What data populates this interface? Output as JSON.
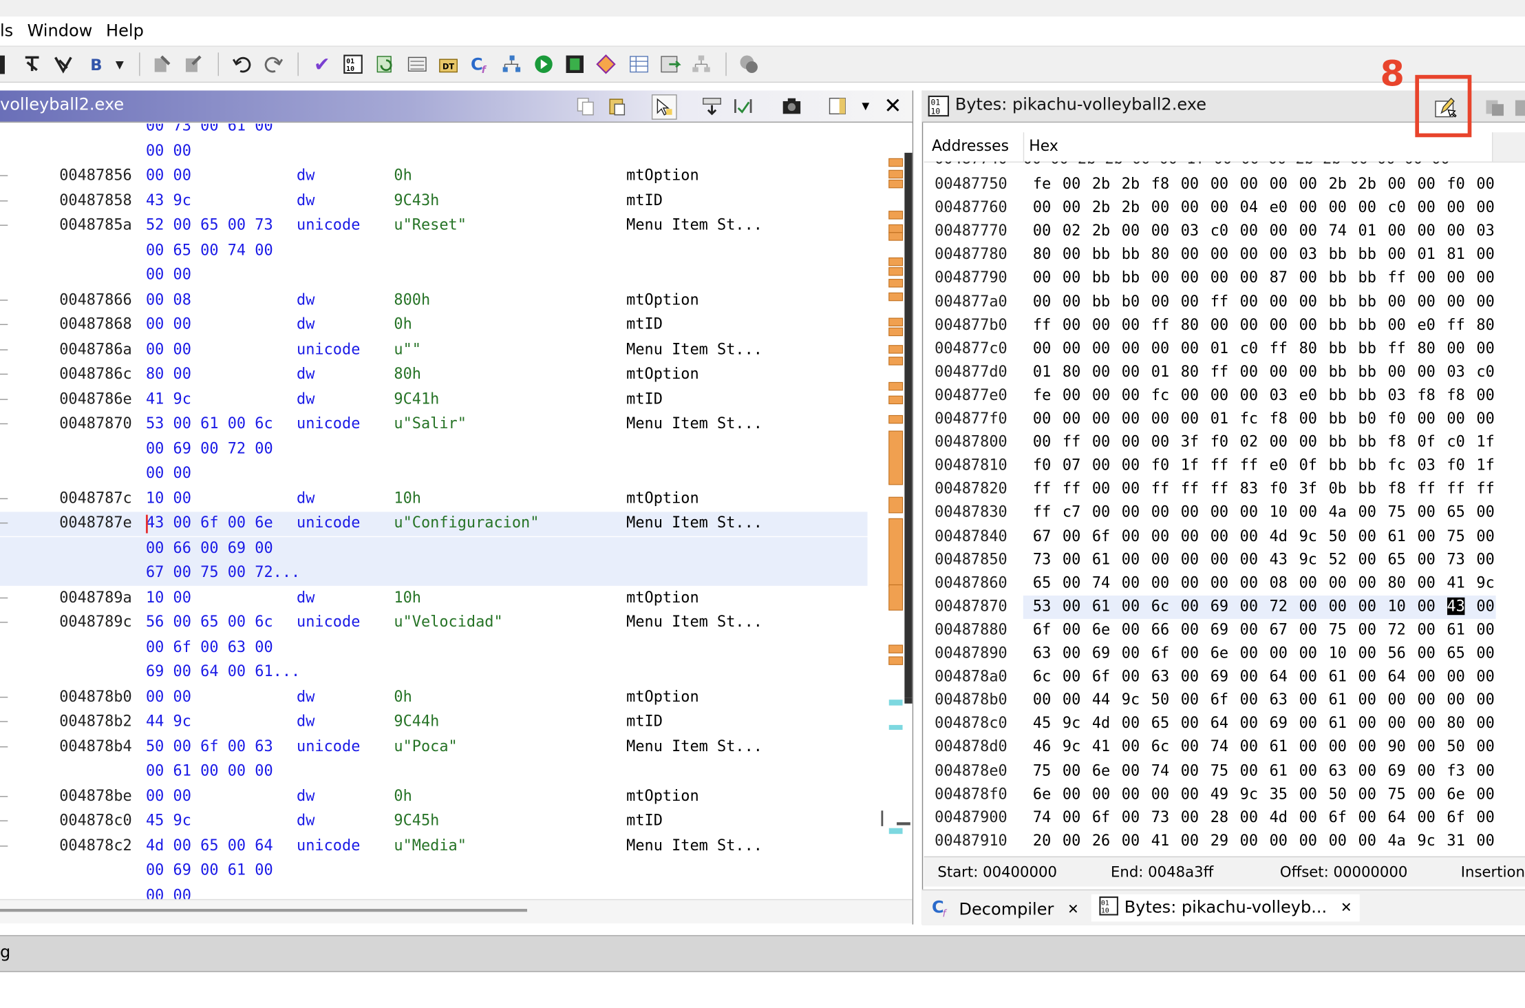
{
  "menu": {
    "items": [
      "ls",
      "Window",
      "Help"
    ]
  },
  "listing": {
    "title": "volleyball2.exe",
    "rows": [
      {
        "addr": "",
        "bytes": "00 73 00 61 00",
        "mnem": "",
        "oper": "",
        "cmt": "",
        "tick": false
      },
      {
        "addr": "",
        "bytes": "00 00",
        "mnem": "",
        "oper": "",
        "cmt": "",
        "tick": false
      },
      {
        "addr": "00487856",
        "bytes": "00 00",
        "mnem": "dw",
        "oper": "0h",
        "cmt": "mtOption",
        "tick": true
      },
      {
        "addr": "00487858",
        "bytes": "43 9c",
        "mnem": "dw",
        "oper": "9C43h",
        "cmt": "mtID",
        "tick": true
      },
      {
        "addr": "0048785a",
        "bytes": "52 00 65 00 73",
        "mnem": "unicode",
        "oper": "u\"Reset\"",
        "cmt": "Menu Item St...",
        "tick": true
      },
      {
        "addr": "",
        "bytes": "00 65 00 74 00",
        "mnem": "",
        "oper": "",
        "cmt": "",
        "tick": false
      },
      {
        "addr": "",
        "bytes": "00 00",
        "mnem": "",
        "oper": "",
        "cmt": "",
        "tick": false
      },
      {
        "addr": "00487866",
        "bytes": "00 08",
        "mnem": "dw",
        "oper": "800h",
        "cmt": "mtOption",
        "tick": true
      },
      {
        "addr": "00487868",
        "bytes": "00 00",
        "mnem": "dw",
        "oper": "0h",
        "cmt": "mtID",
        "tick": true
      },
      {
        "addr": "0048786a",
        "bytes": "00 00",
        "mnem": "unicode",
        "oper": "u\"\"",
        "cmt": "Menu Item St...",
        "tick": true
      },
      {
        "addr": "0048786c",
        "bytes": "80 00",
        "mnem": "dw",
        "oper": "80h",
        "cmt": "mtOption",
        "tick": true
      },
      {
        "addr": "0048786e",
        "bytes": "41 9c",
        "mnem": "dw",
        "oper": "9C41h",
        "cmt": "mtID",
        "tick": true
      },
      {
        "addr": "00487870",
        "bytes": "53 00 61 00 6c",
        "mnem": "unicode",
        "oper": "u\"Salir\"",
        "cmt": "Menu Item St...",
        "tick": true
      },
      {
        "addr": "",
        "bytes": "00 69 00 72 00",
        "mnem": "",
        "oper": "",
        "cmt": "",
        "tick": false
      },
      {
        "addr": "",
        "bytes": "00 00",
        "mnem": "",
        "oper": "",
        "cmt": "",
        "tick": false
      },
      {
        "addr": "0048787c",
        "bytes": "10 00",
        "mnem": "dw",
        "oper": "10h",
        "cmt": "mtOption",
        "tick": true
      },
      {
        "addr": "0048787e",
        "bytes": "43 00 6f 00 6e",
        "mnem": "unicode",
        "oper": "u\"Configuracion\"",
        "cmt": "Menu Item St...",
        "tick": true,
        "sel": true,
        "cursor": true
      },
      {
        "addr": "",
        "bytes": "00 66 00 69 00",
        "mnem": "",
        "oper": "",
        "cmt": "",
        "tick": false,
        "sel": true
      },
      {
        "addr": "",
        "bytes": "67 00 75 00 72...",
        "mnem": "",
        "oper": "",
        "cmt": "",
        "tick": false,
        "sel": true
      },
      {
        "addr": "0048789a",
        "bytes": "10 00",
        "mnem": "dw",
        "oper": "10h",
        "cmt": "mtOption",
        "tick": true
      },
      {
        "addr": "0048789c",
        "bytes": "56 00 65 00 6c",
        "mnem": "unicode",
        "oper": "u\"Velocidad\"",
        "cmt": "Menu Item St...",
        "tick": true
      },
      {
        "addr": "",
        "bytes": "00 6f 00 63 00",
        "mnem": "",
        "oper": "",
        "cmt": "",
        "tick": false
      },
      {
        "addr": "",
        "bytes": "69 00 64 00 61...",
        "mnem": "",
        "oper": "",
        "cmt": "",
        "tick": false
      },
      {
        "addr": "004878b0",
        "bytes": "00 00",
        "mnem": "dw",
        "oper": "0h",
        "cmt": "mtOption",
        "tick": true
      },
      {
        "addr": "004878b2",
        "bytes": "44 9c",
        "mnem": "dw",
        "oper": "9C44h",
        "cmt": "mtID",
        "tick": true
      },
      {
        "addr": "004878b4",
        "bytes": "50 00 6f 00 63",
        "mnem": "unicode",
        "oper": "u\"Poca\"",
        "cmt": "Menu Item St...",
        "tick": true
      },
      {
        "addr": "",
        "bytes": "00 61 00 00 00",
        "mnem": "",
        "oper": "",
        "cmt": "",
        "tick": false
      },
      {
        "addr": "004878be",
        "bytes": "00 00",
        "mnem": "dw",
        "oper": "0h",
        "cmt": "mtOption",
        "tick": true
      },
      {
        "addr": "004878c0",
        "bytes": "45 9c",
        "mnem": "dw",
        "oper": "9C45h",
        "cmt": "mtID",
        "tick": true
      },
      {
        "addr": "004878c2",
        "bytes": "4d 00 65 00 64",
        "mnem": "unicode",
        "oper": "u\"Media\"",
        "cmt": "Menu Item St...",
        "tick": true
      },
      {
        "addr": "",
        "bytes": "00 69 00 61 00",
        "mnem": "",
        "oper": "",
        "cmt": "",
        "tick": false
      },
      {
        "addr": "",
        "bytes": "00 00",
        "mnem": "",
        "oper": "",
        "cmt": "",
        "tick": false
      }
    ]
  },
  "bytes_panel": {
    "title": "Bytes: pikachu-volleyball2.exe",
    "col_addresses": "Addresses",
    "col_hex": "Hex",
    "rows": [
      {
        "addr": "00487750",
        "hex": [
          "fe",
          "00",
          "2b",
          "2b",
          "f8",
          "00",
          "00",
          "00",
          "00",
          "00",
          "2b",
          "2b",
          "00",
          "00",
          "f0",
          "00"
        ]
      },
      {
        "addr": "00487760",
        "hex": [
          "00",
          "00",
          "2b",
          "2b",
          "00",
          "00",
          "00",
          "04",
          "e0",
          "00",
          "00",
          "00",
          "c0",
          "00",
          "00",
          "00"
        ]
      },
      {
        "addr": "00487770",
        "hex": [
          "00",
          "02",
          "2b",
          "00",
          "00",
          "03",
          "c0",
          "00",
          "00",
          "00",
          "74",
          "01",
          "00",
          "00",
          "00",
          "03"
        ]
      },
      {
        "addr": "00487780",
        "hex": [
          "80",
          "00",
          "bb",
          "bb",
          "80",
          "00",
          "00",
          "00",
          "00",
          "03",
          "bb",
          "bb",
          "00",
          "01",
          "81",
          "00"
        ]
      },
      {
        "addr": "00487790",
        "hex": [
          "00",
          "00",
          "bb",
          "bb",
          "00",
          "00",
          "00",
          "00",
          "87",
          "00",
          "bb",
          "bb",
          "ff",
          "00",
          "00",
          "00"
        ]
      },
      {
        "addr": "004877a0",
        "hex": [
          "00",
          "00",
          "bb",
          "b0",
          "00",
          "00",
          "ff",
          "00",
          "00",
          "00",
          "bb",
          "bb",
          "00",
          "00",
          "00",
          "00"
        ]
      },
      {
        "addr": "004877b0",
        "hex": [
          "ff",
          "00",
          "00",
          "00",
          "ff",
          "80",
          "00",
          "00",
          "00",
          "00",
          "bb",
          "bb",
          "00",
          "e0",
          "ff",
          "80"
        ]
      },
      {
        "addr": "004877c0",
        "hex": [
          "00",
          "00",
          "00",
          "00",
          "00",
          "00",
          "01",
          "c0",
          "ff",
          "80",
          "bb",
          "bb",
          "ff",
          "80",
          "00",
          "00"
        ]
      },
      {
        "addr": "004877d0",
        "hex": [
          "01",
          "80",
          "00",
          "00",
          "01",
          "80",
          "ff",
          "00",
          "00",
          "00",
          "bb",
          "bb",
          "00",
          "00",
          "03",
          "c0"
        ]
      },
      {
        "addr": "004877e0",
        "hex": [
          "fe",
          "00",
          "00",
          "00",
          "fc",
          "00",
          "00",
          "00",
          "03",
          "e0",
          "bb",
          "bb",
          "03",
          "f8",
          "f8",
          "00"
        ]
      },
      {
        "addr": "004877f0",
        "hex": [
          "00",
          "00",
          "00",
          "00",
          "00",
          "00",
          "01",
          "fc",
          "f8",
          "00",
          "bb",
          "b0",
          "f0",
          "00",
          "00",
          "00"
        ]
      },
      {
        "addr": "00487800",
        "hex": [
          "00",
          "ff",
          "00",
          "00",
          "00",
          "3f",
          "f0",
          "02",
          "00",
          "00",
          "bb",
          "bb",
          "f8",
          "0f",
          "c0",
          "1f"
        ]
      },
      {
        "addr": "00487810",
        "hex": [
          "f0",
          "07",
          "00",
          "00",
          "f0",
          "1f",
          "ff",
          "ff",
          "e0",
          "0f",
          "bb",
          "bb",
          "fc",
          "03",
          "f0",
          "1f"
        ]
      },
      {
        "addr": "00487820",
        "hex": [
          "ff",
          "ff",
          "00",
          "00",
          "ff",
          "ff",
          "ff",
          "83",
          "f0",
          "3f",
          "0b",
          "bb",
          "f8",
          "ff",
          "ff",
          "ff"
        ]
      },
      {
        "addr": "00487830",
        "hex": [
          "ff",
          "c7",
          "00",
          "00",
          "00",
          "00",
          "00",
          "00",
          "10",
          "00",
          "4a",
          "00",
          "75",
          "00",
          "65",
          "00"
        ]
      },
      {
        "addr": "00487840",
        "hex": [
          "67",
          "00",
          "6f",
          "00",
          "00",
          "00",
          "00",
          "00",
          "4d",
          "9c",
          "50",
          "00",
          "61",
          "00",
          "75",
          "00"
        ]
      },
      {
        "addr": "00487850",
        "hex": [
          "73",
          "00",
          "61",
          "00",
          "00",
          "00",
          "00",
          "00",
          "43",
          "9c",
          "52",
          "00",
          "65",
          "00",
          "73",
          "00"
        ]
      },
      {
        "addr": "00487860",
        "hex": [
          "65",
          "00",
          "74",
          "00",
          "00",
          "00",
          "00",
          "00",
          "08",
          "00",
          "00",
          "00",
          "80",
          "00",
          "41",
          "9c"
        ]
      },
      {
        "addr": "00487870",
        "hex": [
          "53",
          "00",
          "61",
          "00",
          "6c",
          "00",
          "69",
          "00",
          "72",
          "00",
          "00",
          "00",
          "10",
          "00",
          "43",
          "00"
        ],
        "sel": true,
        "hl": 14
      },
      {
        "addr": "00487880",
        "hex": [
          "6f",
          "00",
          "6e",
          "00",
          "66",
          "00",
          "69",
          "00",
          "67",
          "00",
          "75",
          "00",
          "72",
          "00",
          "61",
          "00"
        ]
      },
      {
        "addr": "00487890",
        "hex": [
          "63",
          "00",
          "69",
          "00",
          "6f",
          "00",
          "6e",
          "00",
          "00",
          "00",
          "10",
          "00",
          "56",
          "00",
          "65",
          "00"
        ]
      },
      {
        "addr": "004878a0",
        "hex": [
          "6c",
          "00",
          "6f",
          "00",
          "63",
          "00",
          "69",
          "00",
          "64",
          "00",
          "61",
          "00",
          "64",
          "00",
          "00",
          "00"
        ]
      },
      {
        "addr": "004878b0",
        "hex": [
          "00",
          "00",
          "44",
          "9c",
          "50",
          "00",
          "6f",
          "00",
          "63",
          "00",
          "61",
          "00",
          "00",
          "00",
          "00",
          "00"
        ]
      },
      {
        "addr": "004878c0",
        "hex": [
          "45",
          "9c",
          "4d",
          "00",
          "65",
          "00",
          "64",
          "00",
          "69",
          "00",
          "61",
          "00",
          "00",
          "00",
          "80",
          "00"
        ]
      },
      {
        "addr": "004878d0",
        "hex": [
          "46",
          "9c",
          "41",
          "00",
          "6c",
          "00",
          "74",
          "00",
          "61",
          "00",
          "00",
          "00",
          "90",
          "00",
          "50",
          "00"
        ]
      },
      {
        "addr": "004878e0",
        "hex": [
          "75",
          "00",
          "6e",
          "00",
          "74",
          "00",
          "75",
          "00",
          "61",
          "00",
          "63",
          "00",
          "69",
          "00",
          "f3",
          "00"
        ]
      },
      {
        "addr": "004878f0",
        "hex": [
          "6e",
          "00",
          "00",
          "00",
          "00",
          "00",
          "49",
          "9c",
          "35",
          "00",
          "50",
          "00",
          "75",
          "00",
          "6e",
          "00"
        ]
      },
      {
        "addr": "00487900",
        "hex": [
          "74",
          "00",
          "6f",
          "00",
          "73",
          "00",
          "28",
          "00",
          "4d",
          "00",
          "6f",
          "00",
          "64",
          "00",
          "6f",
          "00"
        ]
      },
      {
        "addr": "00487910",
        "hex": [
          "20",
          "00",
          "26",
          "00",
          "41",
          "00",
          "29",
          "00",
          "00",
          "00",
          "00",
          "00",
          "4a",
          "9c",
          "31",
          "00"
        ]
      }
    ],
    "status": {
      "start": "Start: 00400000",
      "end": "End: 0048a3ff",
      "offset": "Offset: 00000000",
      "insertion": "Insertion:"
    }
  },
  "tabs": {
    "decompiler": "Decompiler",
    "bytes": "Bytes: pikachu-volleyb..."
  },
  "statusbar": {
    "text": "g"
  },
  "annotation": {
    "number": "8",
    "color": "#e8442c"
  }
}
